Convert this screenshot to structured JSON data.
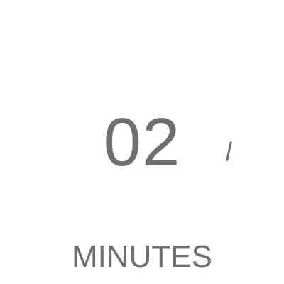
{
  "timer": {
    "value": "02",
    "unit_label": "MINUTES"
  },
  "colors": {
    "text": "#6f6f6f",
    "background": "#ffffff"
  }
}
